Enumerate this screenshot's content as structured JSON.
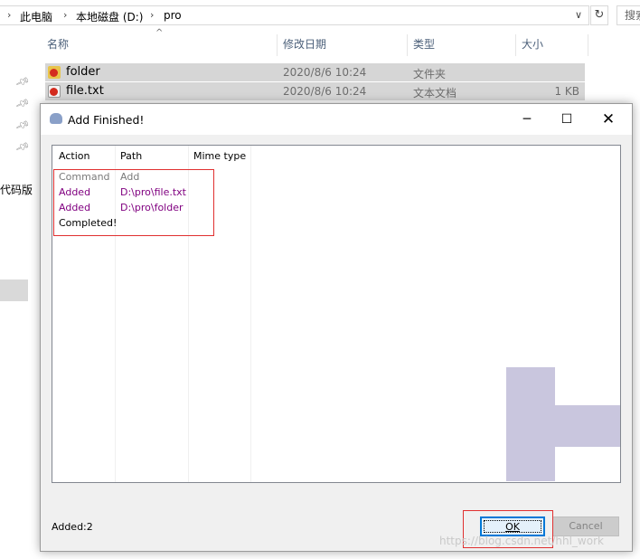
{
  "explorer": {
    "breadcrumb": [
      "此电脑",
      "本地磁盘 (D:)",
      "pro"
    ],
    "search_placeholder": "搜索",
    "columns": {
      "name": "名称",
      "modified": "修改日期",
      "type": "类型",
      "size": "大小"
    },
    "files": [
      {
        "name": "folder",
        "modified": "2020/8/6 10:24",
        "type": "文件夹",
        "size": ""
      },
      {
        "name": "file.txt",
        "modified": "2020/8/6 10:24",
        "type": "文本文档",
        "size": "1 KB"
      }
    ],
    "nav_partial_label": "代码版"
  },
  "dialog": {
    "title": "Add Finished!",
    "columns": {
      "action": "Action",
      "path": "Path",
      "mime": "Mime type"
    },
    "rows": [
      {
        "action": "Command",
        "path": "Add",
        "color": "#7a7a7a"
      },
      {
        "action": "Added",
        "path": "D:\\pro\\file.txt",
        "color": "#800080"
      },
      {
        "action": "Added",
        "path": "D:\\pro\\folder",
        "color": "#800080"
      },
      {
        "action": "Completed!",
        "path": "",
        "color": "#000000"
      }
    ],
    "status": "Added:2",
    "ok_label": "OK",
    "cancel_label": "Cancel"
  },
  "watermark": "https://blog.csdn.net/hhl_work",
  "colors": {
    "accent": "#0078d7",
    "highlight_box": "#e03030",
    "added_text": "#800080",
    "selection": "#d6d6d6"
  }
}
